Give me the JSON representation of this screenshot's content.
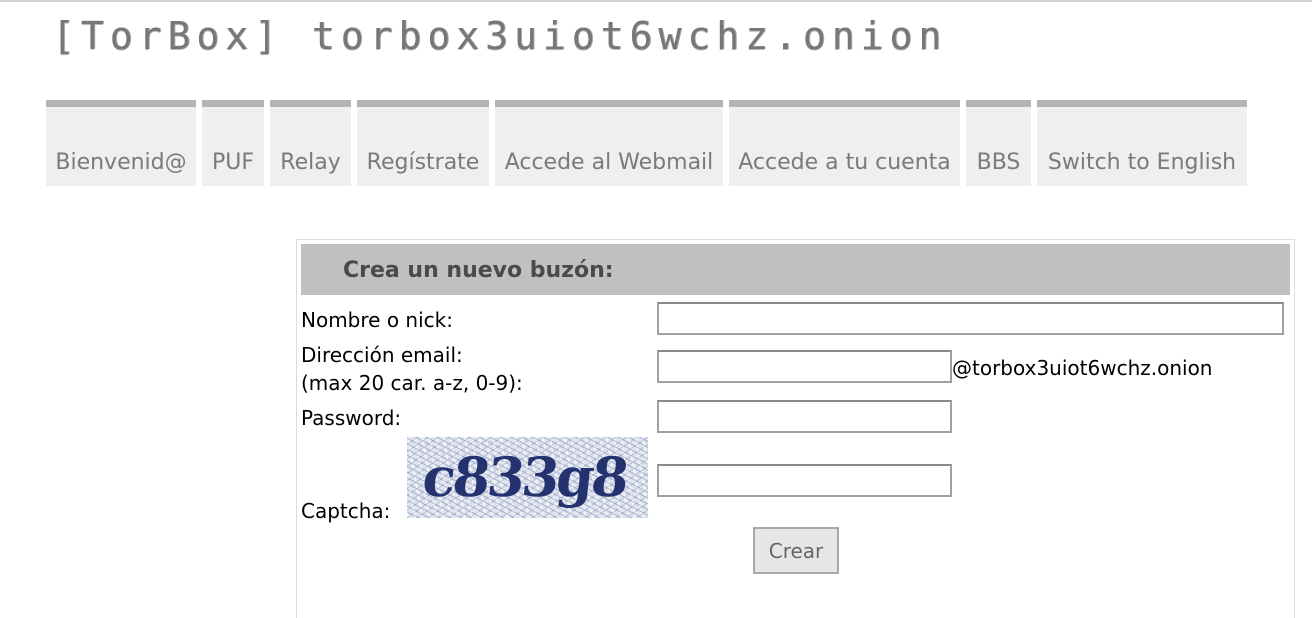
{
  "site": {
    "title": "[TorBox] torbox3uiot6wchz.onion"
  },
  "nav": {
    "tabs": [
      {
        "label": "Bienvenid@"
      },
      {
        "label": "PUF"
      },
      {
        "label": "Relay"
      },
      {
        "label": "Regístrate"
      },
      {
        "label": "Accede al Webmail"
      },
      {
        "label": "Accede a tu cuenta"
      },
      {
        "label": "BBS"
      },
      {
        "label": "Switch to English"
      }
    ]
  },
  "form": {
    "heading": "Crea un nuevo buzón:",
    "nick_label": "Nombre o nick:",
    "nick_value": "",
    "email_label_line1": "Dirección email:",
    "email_label_line2": "(max 20 car. a-z, 0-9):",
    "email_value": "",
    "email_domain": "@torbox3uiot6wchz.onion",
    "password_label": "Password:",
    "password_value": "",
    "captcha_label": "Captcha:",
    "captcha_text": "c833g8",
    "captcha_value": "",
    "submit_label": "Crear"
  }
}
